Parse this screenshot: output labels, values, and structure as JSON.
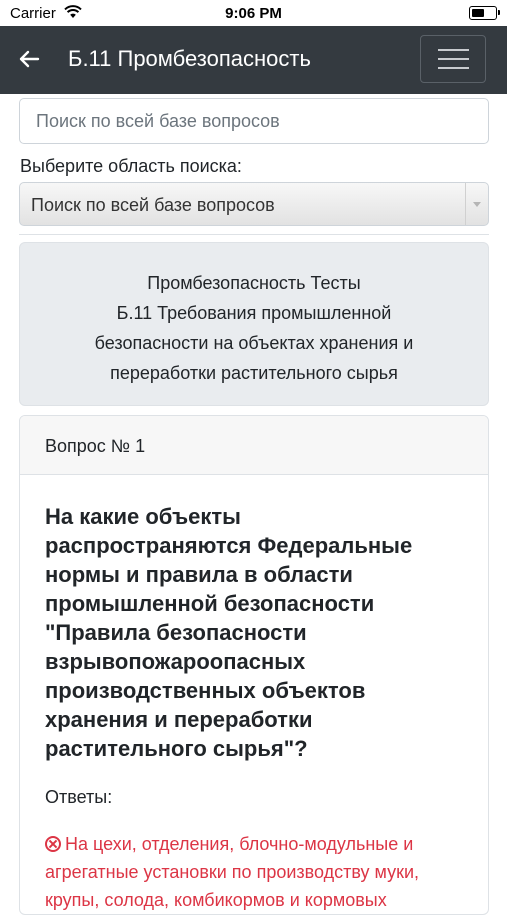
{
  "status_bar": {
    "carrier": "Carrier",
    "time": "9:06 PM"
  },
  "navbar": {
    "title": "Б.11 Промбезопасность"
  },
  "search": {
    "placeholder": "Поиск по всей базе вопросов"
  },
  "area": {
    "label": "Выберите область поиска:",
    "selected": "Поиск по всей базе вопросов"
  },
  "info": {
    "lines": [
      "Промбезопасность Тесты",
      "Б.11 Требования промышленной",
      "безопасности на объектах хранения и",
      "переработки растительного сырья"
    ]
  },
  "question": {
    "header": "Вопрос № 1",
    "text_lines": [
      "На какие объекты",
      "распространяются Федеральные",
      "нормы и правила в области",
      "промышленной безопасности",
      "\"Правила безопасности",
      "взрывопожароопасных",
      "производственных объектов",
      "хранения и переработки",
      "растительного сырья\"?"
    ],
    "answers_label": "Ответы:",
    "answer_lines": [
      "На цехи, отделения, блочно-модульные и",
      "агрегатные установки по производству муки,",
      "крупы, солода, комбикормов и кормовых"
    ]
  }
}
